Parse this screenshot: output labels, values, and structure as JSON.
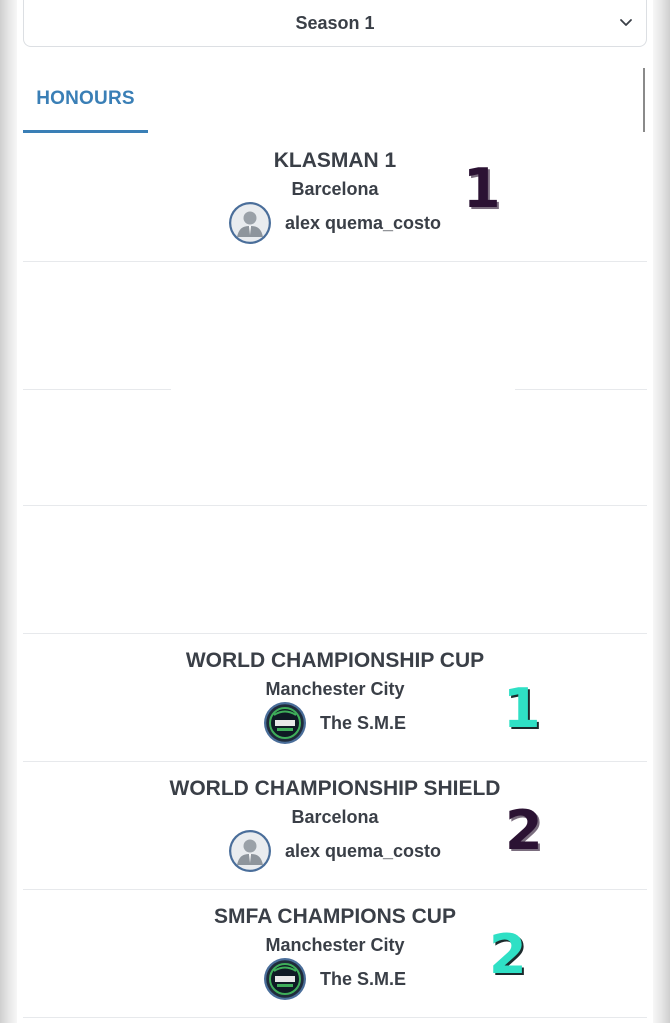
{
  "season_select": {
    "value": "Season 1"
  },
  "tabs": [
    {
      "label": "HONOURS",
      "active": true
    }
  ],
  "honours": [
    {
      "title": "KLASMAN 1",
      "club": "Barcelona",
      "manager": "alex quema_costo",
      "avatar": "default-user-avatar",
      "rank": "1",
      "rank_color": "dark"
    },
    {
      "title": "WORLD CHAMPIONSHIP CUP",
      "club": "Manchester City",
      "manager": "The S.M.E",
      "avatar": "soccer-manager-badge",
      "rank": "1",
      "rank_color": "teal"
    },
    {
      "title": "WORLD CHAMPIONSHIP SHIELD",
      "club": "Barcelona",
      "manager": "alex quema_costo",
      "avatar": "default-user-avatar",
      "rank": "2",
      "rank_color": "dark"
    },
    {
      "title": "SMFA CHAMPIONS CUP",
      "club": "Manchester City",
      "manager": "The S.M.E",
      "avatar": "soccer-manager-badge",
      "rank": "2",
      "rank_color": "teal"
    }
  ],
  "colors": {
    "accent": "#3a7fb6",
    "text": "#3a3f47",
    "rank_dark": "#2b1233",
    "rank_teal": "#2fe0c5"
  }
}
